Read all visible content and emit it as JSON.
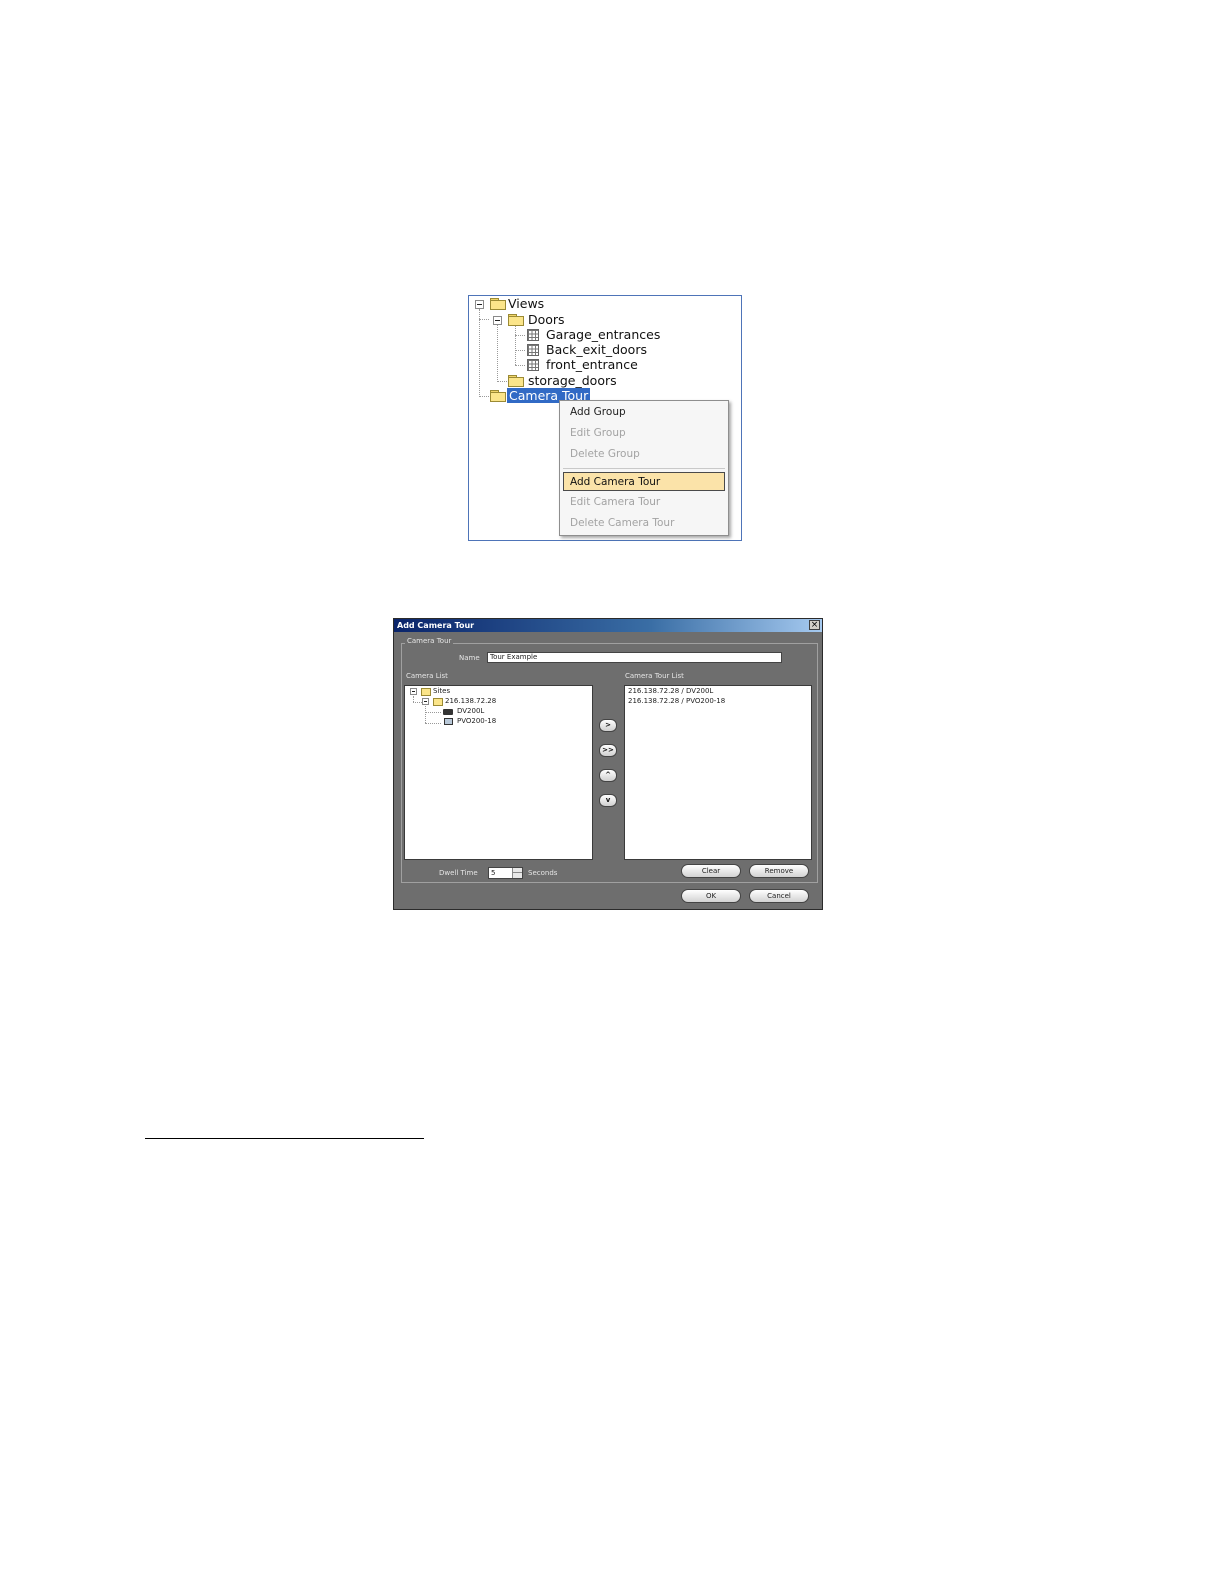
{
  "tree": {
    "nodes": {
      "views": "Views",
      "doors": "Doors",
      "garage": "Garage_entrances",
      "back_exit": "Back_exit_doors",
      "front": "front_entrance",
      "storage": "storage_doors",
      "camera_tour": "Camera Tour"
    },
    "selection_color": "#316ac5"
  },
  "context_menu": {
    "items": [
      {
        "label": "Add Group",
        "enabled": true
      },
      {
        "label": "Edit Group",
        "enabled": false
      },
      {
        "label": "Delete Group",
        "enabled": false
      },
      {
        "label": "Add Camera Tour",
        "enabled": true,
        "highlighted": true
      },
      {
        "label": "Edit Camera Tour",
        "enabled": false
      },
      {
        "label": "Delete Camera Tour",
        "enabled": false
      }
    ],
    "highlight_color": "#fbe3a9"
  },
  "dialog": {
    "title": "Add Camera Tour",
    "close_glyph": "×",
    "group_label": "Camera Tour",
    "name_label": "Name",
    "name_value": "Tour Example",
    "camera_list_label": "Camera List",
    "camera_tour_list_label": "Camera Tour List",
    "camera_tree": {
      "root": "Sites",
      "site": "216.138.72.28",
      "cameras": [
        "DV200L",
        "PVO200-18"
      ]
    },
    "tour_items": [
      "216.138.72.28 / DV200L",
      "216.138.72.28 / PVO200-18"
    ],
    "arrow_buttons": [
      ">",
      ">>",
      "^",
      "v"
    ],
    "dwell_label": "Dwell Time",
    "dwell_value": "5",
    "seconds_label": "Seconds",
    "clear_label": "Clear",
    "remove_label": "Remove",
    "ok_label": "OK",
    "cancel_label": "Cancel"
  }
}
